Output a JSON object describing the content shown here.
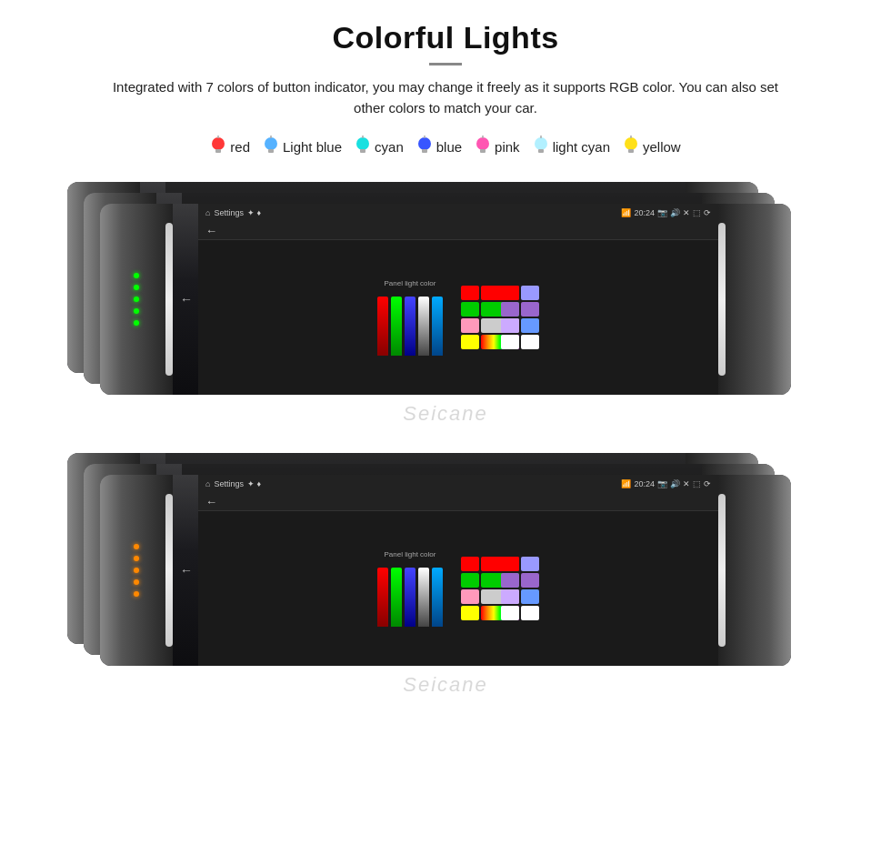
{
  "header": {
    "title": "Colorful Lights",
    "description": "Integrated with 7 colors of button indicator, you may change it freely as it supports RGB color. You can also set other colors to match your car."
  },
  "colors": [
    {
      "label": "red",
      "color": "#ff2222",
      "bulb_color": "#ff4444"
    },
    {
      "label": "Light blue",
      "color": "#44aaff",
      "bulb_color": "#66bbff"
    },
    {
      "label": "cyan",
      "color": "#00dddd",
      "bulb_color": "#00ffff"
    },
    {
      "label": "blue",
      "color": "#2244ff",
      "bulb_color": "#4466ff"
    },
    {
      "label": "pink",
      "color": "#ff44aa",
      "bulb_color": "#ff66cc"
    },
    {
      "label": "light cyan",
      "color": "#aaeeff",
      "bulb_color": "#ccffff"
    },
    {
      "label": "yellow",
      "color": "#ffdd00",
      "bulb_color": "#ffee44"
    }
  ],
  "android": {
    "title": "Settings",
    "time": "20:24",
    "back": "←",
    "panel_label": "Panel light color"
  },
  "watermark": "Seicane",
  "top_group": {
    "layers": 3,
    "led_colors_top": [
      "#ff0000",
      "#00ff00",
      "#0000ff"
    ],
    "led_colors_bottom": [
      "#ff8800",
      "#ff00ff",
      "#00ffff"
    ]
  },
  "bottom_group": {
    "layers": 3,
    "led_colors_top": [
      "#ff0000",
      "#00ff00",
      "#0000ff"
    ],
    "led_colors_bottom": [
      "#ff8800",
      "#ff00ff",
      "#00ffff"
    ]
  },
  "swatches_top": [
    "#ff0000",
    "#00cc00",
    "#9999ff",
    "#6600cc",
    "#ff6666",
    "#33ff33",
    "#9966cc",
    "#ccaaff",
    "#ff66aa",
    "#999999",
    "#ffffff",
    "#6699ff",
    "#ffff00",
    "#ffcc00",
    "#ffffff",
    "#ff6633"
  ],
  "swatches_bottom": [
    "#ff0000",
    "#00cc00",
    "#9999ff",
    "#6600cc",
    "#ff6666",
    "#33ff33",
    "#9966cc",
    "#ccaaff",
    "#ff66aa",
    "#999999",
    "#ffffff",
    "#6699ff",
    "#ffff00",
    "#ffcc00",
    "#ffffff",
    "#ff6633"
  ]
}
